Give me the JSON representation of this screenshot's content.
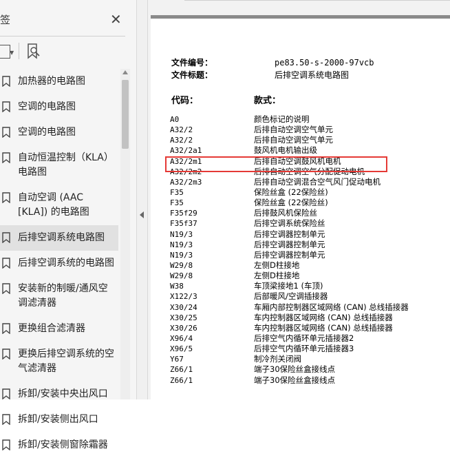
{
  "sidebar": {
    "title": "签",
    "items": [
      {
        "label": "加热器的电路图"
      },
      {
        "label": "空调的电路图"
      },
      {
        "label": "空调的电路图"
      },
      {
        "label": "自动恒温控制（KLA）电路图"
      },
      {
        "label": "自动空调 (AAC [KLA]) 的电路图"
      },
      {
        "label": "后排空调系统电路图",
        "selected": true
      },
      {
        "label": "后排空调系统的电路图"
      },
      {
        "label": "安装新的制暖/通风空调滤清器"
      },
      {
        "label": "更换组合滤清器"
      },
      {
        "label": "更换后排空调系统的空气滤清器"
      },
      {
        "label": "拆卸/安装中央出风口"
      },
      {
        "label": "拆卸/安装侧出风口"
      },
      {
        "label": "拆卸/安装侧窗除霜器"
      }
    ]
  },
  "document": {
    "file_no_label": "文件编号：",
    "file_no_value": "pe83.50-s-2000-97vcb",
    "file_title_label": "文件标题：",
    "file_title_value": "后排空调系统电路图",
    "code_header": "代码：",
    "desc_header": "款式：",
    "rows": [
      {
        "code": "A0",
        "desc": "颜色标记的说明"
      },
      {
        "code": "A32/2",
        "desc": "后排自动空调空气单元"
      },
      {
        "code": "A32/2",
        "desc": "后排自动空调空气单元"
      },
      {
        "code": "A32/2a1",
        "desc": "鼓风机电机输出级"
      },
      {
        "code": "A32/2m1",
        "desc": "后排自动空调鼓风机电机"
      },
      {
        "code": "A32/2m2",
        "desc": "后排自动空调空气分配促动电机"
      },
      {
        "code": "A32/2m3",
        "desc": "后排自动空调混合空气风门促动电机"
      },
      {
        "code": "F35",
        "desc": "保险丝盒 (22保险丝)"
      },
      {
        "code": "F35",
        "desc": "保险丝盒 (22保险丝)"
      },
      {
        "code": "F35f29",
        "desc": "后排鼓风机保险丝"
      },
      {
        "code": "F35f37",
        "desc": "后排空调系统保险丝"
      },
      {
        "code": "N19/3",
        "desc": "后排空调器控制单元"
      },
      {
        "code": "N19/3",
        "desc": "后排空调器控制单元"
      },
      {
        "code": "N19/3",
        "desc": "后排空调器控制单元"
      },
      {
        "code": "W29/8",
        "desc": "左侧D柱接地"
      },
      {
        "code": "W29/8",
        "desc": "左侧D柱接地"
      },
      {
        "code": "W38",
        "desc": "车顶梁接地1 (车顶)"
      },
      {
        "code": "X122/3",
        "desc": "后部暖风/空调插接器"
      },
      {
        "code": "X30/24",
        "desc": "车厢内部控制器区域网络 (CAN) 总线插接器"
      },
      {
        "code": "X30/25",
        "desc": "车内控制器区域网络 (CAN) 总线插接器"
      },
      {
        "code": "X30/26",
        "desc": "车内控制器区域网络 (CAN) 总线插接器"
      },
      {
        "code": "X96/4",
        "desc": "后排空气内循环单元插接器2"
      },
      {
        "code": "X96/5",
        "desc": "后排空气内循环单元插接器3"
      },
      {
        "code": "Y67",
        "desc": "制冷剂关闭阀"
      },
      {
        "code": "Z66/1",
        "desc": "端子30保险丝盒接线点"
      },
      {
        "code": "Z66/1",
        "desc": "端子30保险丝盒接线点"
      }
    ]
  },
  "colors": {
    "highlight": "#e53935",
    "panel_bg": "#f5f5f5",
    "selected_bg": "#e1e1e1"
  }
}
